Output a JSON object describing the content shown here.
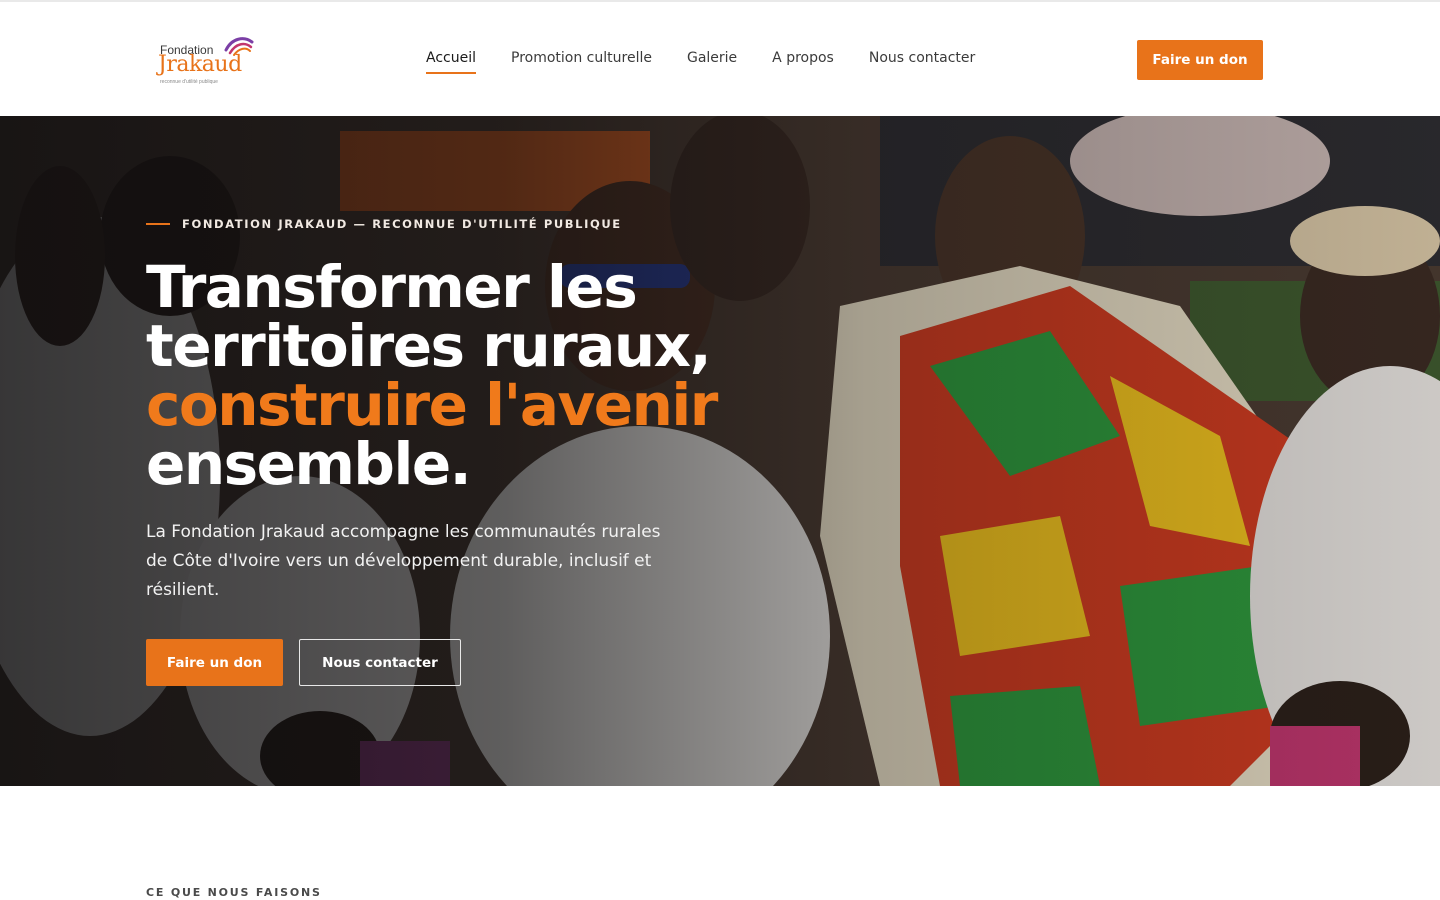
{
  "brand": {
    "logo_small": "Fondation",
    "logo_big": "Jrakaud",
    "logo_tagline": "reconnue d'utilité publique",
    "accent_color": "#e8731a"
  },
  "nav": {
    "items": [
      {
        "label": "Accueil",
        "active": true
      },
      {
        "label": "Promotion culturelle",
        "active": false
      },
      {
        "label": "Galerie",
        "active": false
      },
      {
        "label": "A propos",
        "active": false
      },
      {
        "label": "Nous contacter",
        "active": false
      }
    ],
    "cta_label": "Faire un don"
  },
  "hero": {
    "eyebrow": "FONDATION JRAKAUD — RECONNUE D'UTILITÉ PUBLIQUE",
    "title_part1": "Transformer les territoires ruraux, ",
    "title_accent": "construire l'avenir",
    "title_part2": " ensemble.",
    "description": "La Fondation Jrakaud accompagne les communautés rurales de Côte d'Ivoire vers un développement durable, inclusif et résilient.",
    "primary_button": "Faire un don",
    "secondary_button": "Nous contacter"
  },
  "next_section": {
    "label": "CE QUE NOUS FAISONS"
  }
}
